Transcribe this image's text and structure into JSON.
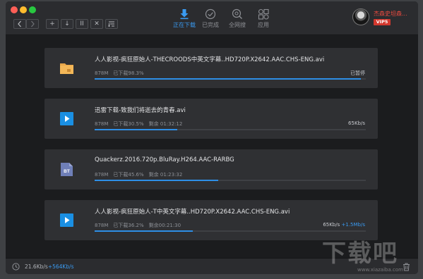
{
  "toolbar": {
    "back_icon": "chevron-left-icon",
    "forward_icon": "chevron-right-icon",
    "new_label": "+",
    "start_label": "↓",
    "pause_label": "II",
    "delete_label": "✕",
    "sort_icon": "list-sort-icon"
  },
  "tabs": [
    {
      "label": "正在下载",
      "icon": "download-icon",
      "active": true
    },
    {
      "label": "已完成",
      "icon": "check-circle-icon",
      "active": false
    },
    {
      "label": "全网搜",
      "icon": "search-globe-icon",
      "active": false
    },
    {
      "label": "应用",
      "icon": "apps-grid-icon",
      "active": false
    }
  ],
  "user": {
    "name": "杰森史坦森...",
    "badge": "VIP5"
  },
  "downloads": [
    {
      "name": "人人影视-疯狂原始人-THECROODS中英文字幕..HD720P.X2642.AAC.CHS-ENG.avi",
      "icon": "folder-icon",
      "size": "878M",
      "status": "已下载98.3%",
      "remaining": "",
      "speed": "",
      "accel": "",
      "right_text": "已暂停",
      "progress": 0.983
    },
    {
      "name": "迅雷下载-致我们将逝去的青春.avi",
      "icon": "video-play-icon",
      "size": "878M",
      "status": "已下载30.5%",
      "remaining": "剩余 01:32:12",
      "speed": "65Kb/s",
      "accel": "",
      "right_text": "",
      "progress": 0.305
    },
    {
      "name": "Quackerz.2016.720p.BluRay.H264.AAC-RARBG",
      "icon": "bt-file-icon",
      "size": "878M",
      "status": "已下载45.6%",
      "remaining": "剩余 01:23:32",
      "speed": "",
      "accel": "",
      "right_text": "",
      "progress": 0.456
    },
    {
      "name": "人人影视-疯狂原始人-T中英文字幕..HD720P.X2642.AAC.CHS-ENG.avi",
      "icon": "video-play-icon",
      "size": "878M",
      "status": "已下载36.2%",
      "remaining": "剩余00:21:30",
      "speed": "65Kb/s",
      "accel": "+1.5Mb/s",
      "right_text": "",
      "progress": 0.362
    }
  ],
  "statusbar": {
    "speed": "21.6Kb/s",
    "upload": "+564Kb/s"
  },
  "watermark": {
    "text": "下载吧",
    "url": "www.xiazaiba.com"
  },
  "colors": {
    "accent": "#3a9af0",
    "background": "#1d1e20",
    "card": "#2f3033",
    "progress": "#2e8fe6",
    "vip": "#d3382e"
  }
}
